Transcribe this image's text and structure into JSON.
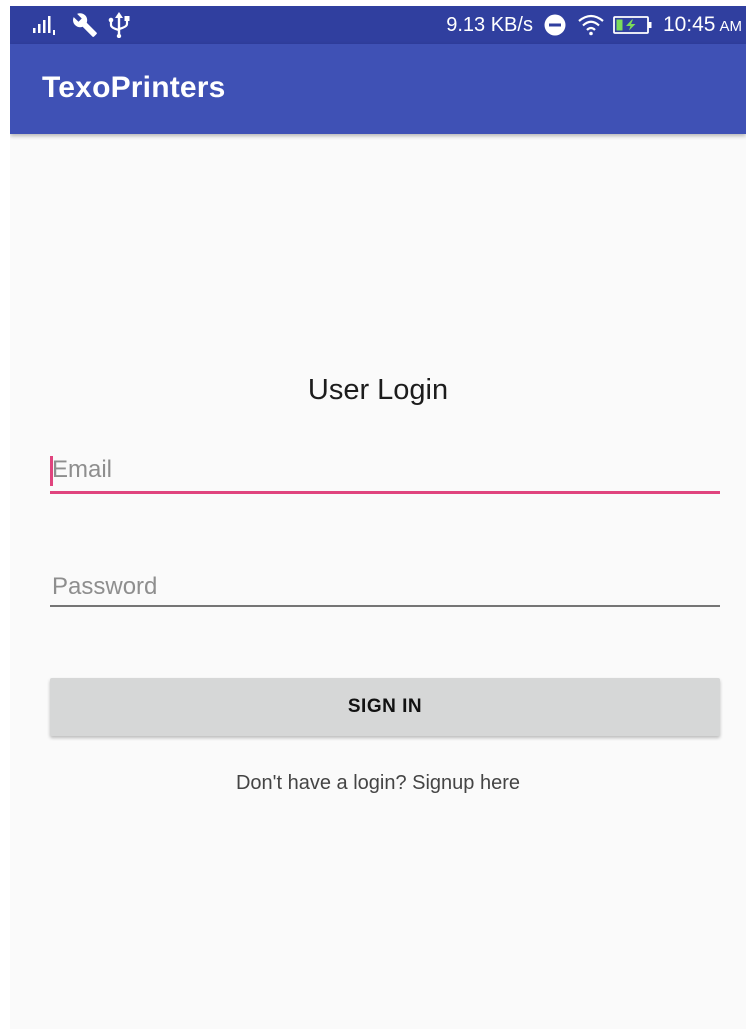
{
  "status_bar": {
    "network_speed": "9.13 KB/s",
    "time": "10:45",
    "ampm": "AM",
    "icons": [
      "signal-icon",
      "wrench-icon",
      "usb-icon",
      "do-not-disturb-icon",
      "wifi-icon",
      "battery-charging-icon"
    ]
  },
  "app_bar": {
    "title": "TexoPrinters"
  },
  "login": {
    "heading": "User Login",
    "email_placeholder": "Email",
    "password_placeholder": "Password",
    "sign_in_label": "SIGN IN",
    "signup_text": "Don't have a login? Signup here"
  },
  "colors": {
    "status_bar": "#303f9f",
    "primary": "#3f51b5",
    "accent": "#e0447e",
    "background": "#fafafa",
    "button": "#d6d7d7"
  }
}
